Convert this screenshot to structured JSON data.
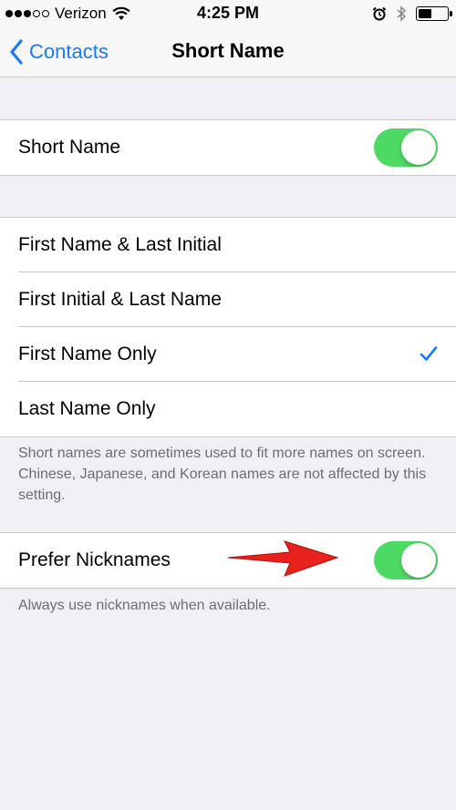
{
  "status_bar": {
    "carrier": "Verizon",
    "time": "4:25 PM",
    "signal_bars_filled": 3,
    "signal_bars_total": 5
  },
  "nav": {
    "back_label": "Contacts",
    "title": "Short Name"
  },
  "short_name_toggle": {
    "label": "Short Name",
    "enabled": true
  },
  "format_options": [
    {
      "label": "First Name & Last Initial",
      "selected": false
    },
    {
      "label": "First Initial & Last Name",
      "selected": false
    },
    {
      "label": "First Name Only",
      "selected": true
    },
    {
      "label": "Last Name Only",
      "selected": false
    }
  ],
  "format_footer": "Short names are sometimes used to fit more names on screen. Chinese, Japanese, and Korean names are not affected by this setting.",
  "nicknames_toggle": {
    "label": "Prefer Nicknames",
    "enabled": true
  },
  "nicknames_footer": "Always use nicknames when available.",
  "colors": {
    "accent": "#1a7cf5",
    "toggle_on": "#4cd964",
    "background": "#efeff4",
    "arrow": "#e8211c"
  },
  "icons": {
    "back": "chevron-left-icon",
    "checkmark": "checkmark-icon",
    "wifi": "wifi-icon",
    "alarm": "alarm-icon",
    "bluetooth": "bluetooth-icon",
    "battery": "battery-icon"
  }
}
